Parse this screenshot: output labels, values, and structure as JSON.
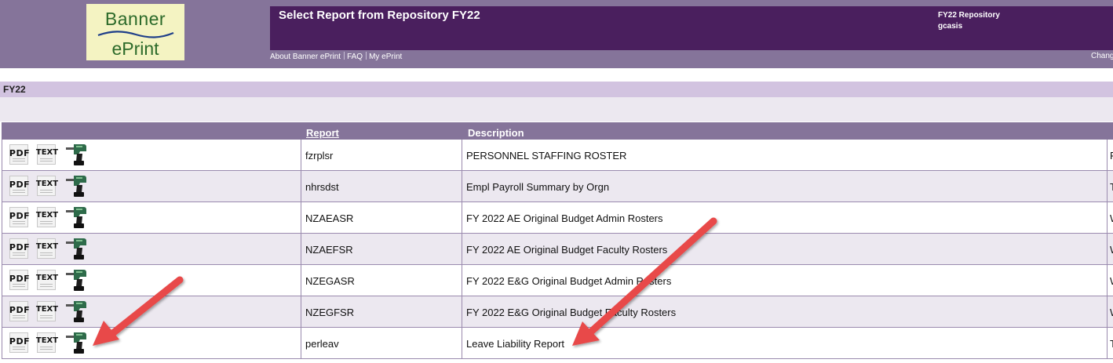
{
  "header": {
    "logo_line1": "Banner",
    "logo_line2": "ePrint",
    "title": "Select Report from Repository FY22",
    "repository_label": "FY22 Repository",
    "user": "gcasis",
    "links": [
      "About Banner ePrint",
      "FAQ",
      "My ePrint"
    ],
    "right_link": "Chang",
    "colors": {
      "header_bg": "#85749a",
      "title_band": "#4a1f5e",
      "section_bar": "#d2c3e0",
      "annotation_arrow": "#e8484a"
    }
  },
  "section": {
    "name": "FY22"
  },
  "table": {
    "columns": {
      "report": "Report",
      "description": "Description"
    },
    "action_icons": {
      "pdf": "PDF",
      "text": "TEXT",
      "drill": "drill-icon"
    },
    "rows": [
      {
        "report": "fzrplsr",
        "description": "PERSONNEL STAFFING ROSTER",
        "extra": "F"
      },
      {
        "report": "nhrsdst",
        "description": "Empl Payroll Summary by Orgn",
        "extra": "T"
      },
      {
        "report": "NZAEASR",
        "description": "FY 2022 AE Original Budget Admin Rosters",
        "extra": "W"
      },
      {
        "report": "NZAEFSR",
        "description": "FY 2022 AE Original Budget Faculty Rosters",
        "extra": "W"
      },
      {
        "report": "NZEGASR",
        "description": "FY 2022 E&G Original Budget Admin Rosters",
        "extra": "W"
      },
      {
        "report": "NZEGFSR",
        "description": "FY 2022 E&G Original Budget Faculty Rosters",
        "extra": "W"
      },
      {
        "report": "perleav",
        "description": "Leave Liability Report",
        "extra": "T"
      }
    ]
  }
}
